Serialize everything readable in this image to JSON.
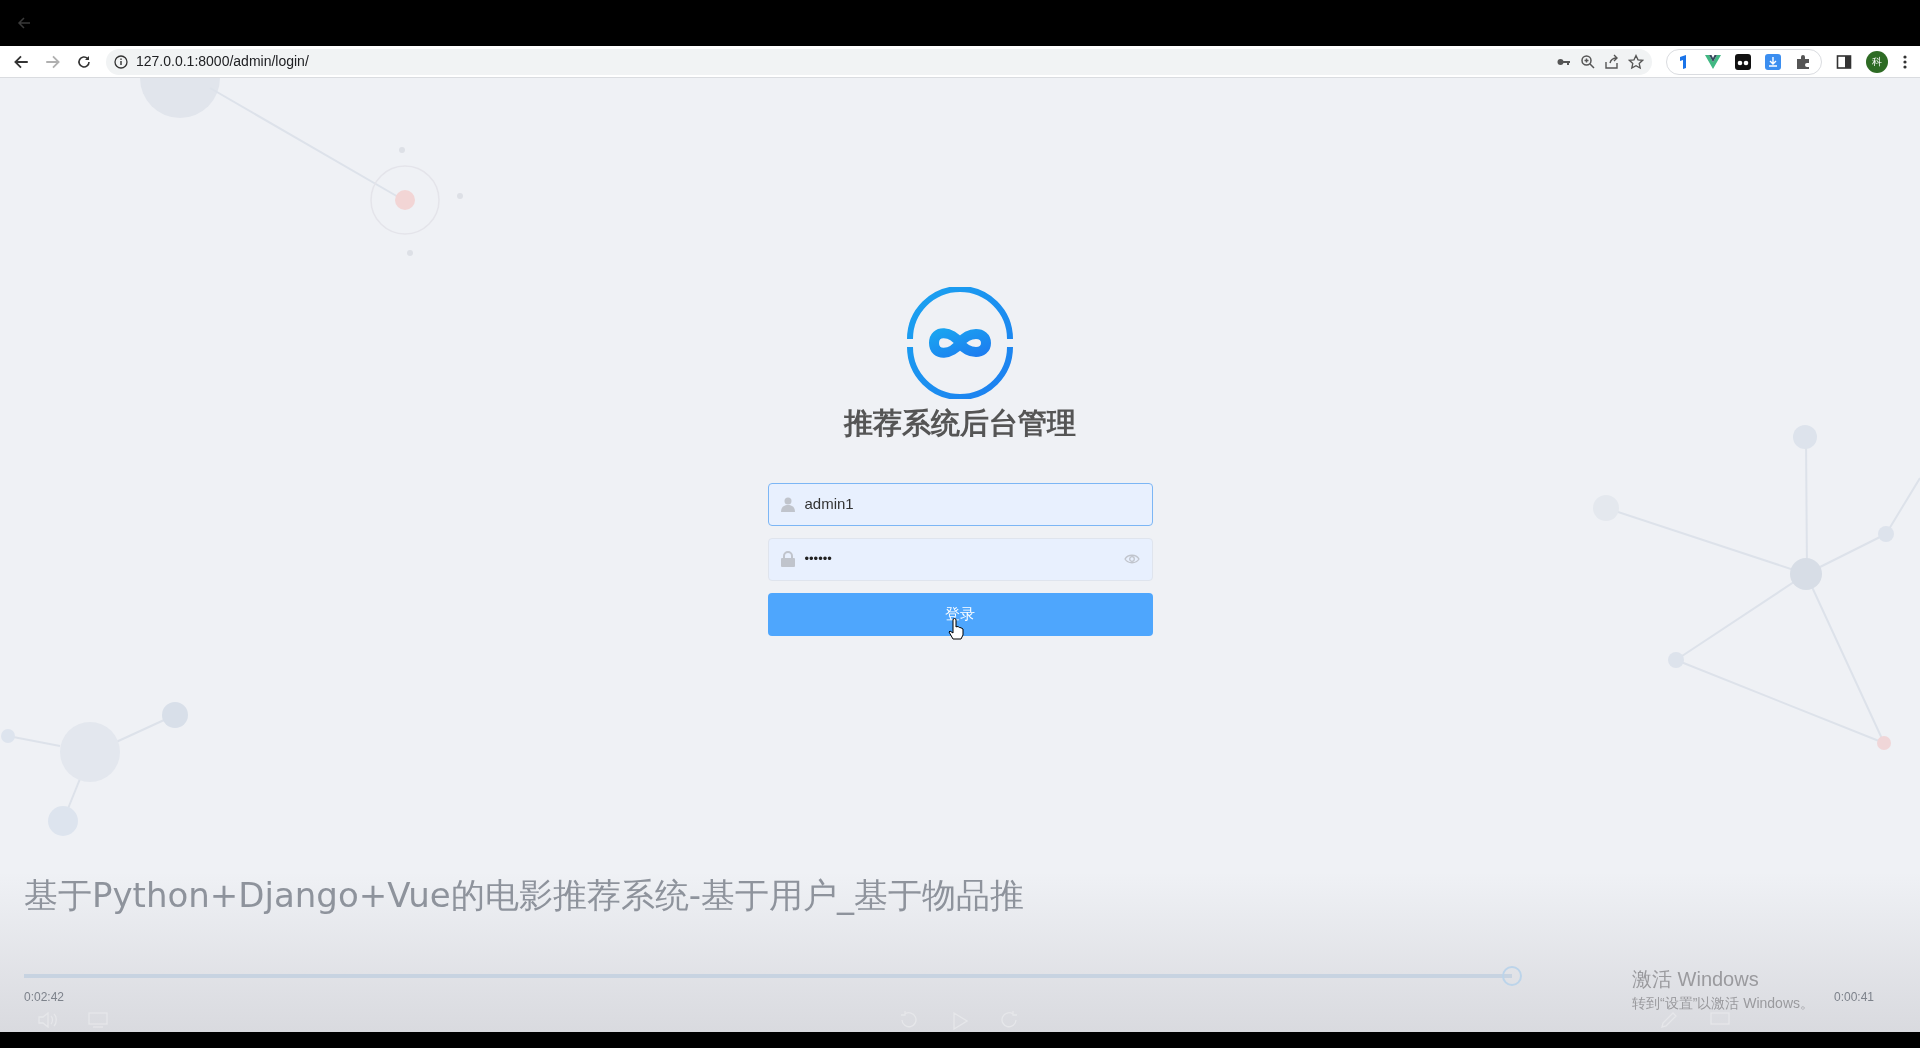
{
  "browser": {
    "url": "127.0.0.1:8000/admin/login/",
    "forward_disabled": true,
    "profile_initial": "科"
  },
  "login": {
    "title": "推荐系统后台管理",
    "username": {
      "value": "admin1"
    },
    "password": {
      "value": "••••••"
    },
    "submit": "登录"
  },
  "video": {
    "title": "基于Python+Django+Vue的电影推荐系统-基于用户_基于物品推",
    "progress": {
      "level": 0.8
    },
    "elapsed": "0:02:42",
    "remaining": "0:00:41"
  },
  "windows_notice": {
    "title": "激活 Windows",
    "hint": "转到“设置”以激活 Windows。"
  }
}
